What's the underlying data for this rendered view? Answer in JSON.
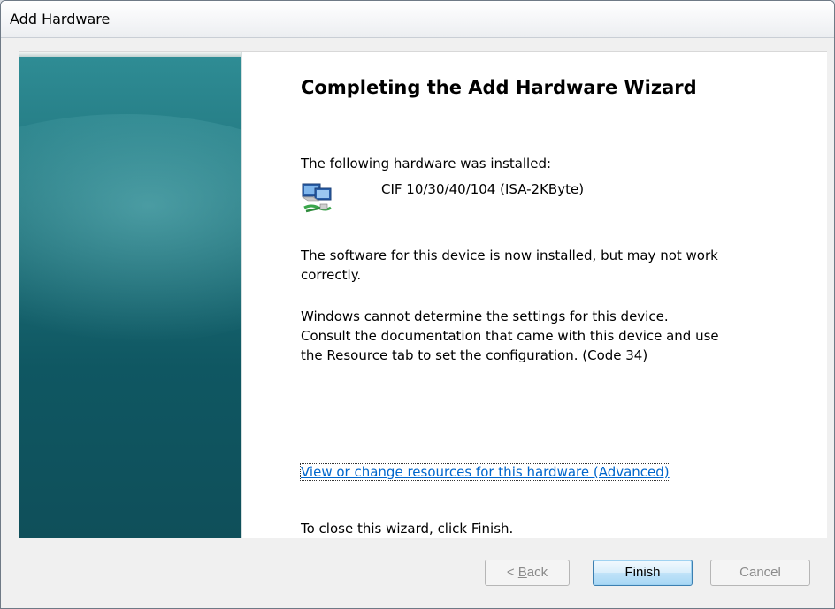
{
  "window": {
    "title": "Add Hardware"
  },
  "wizard": {
    "heading": "Completing the Add Hardware Wizard",
    "installed_label": "The following hardware was installed:",
    "device_icon": "network-adapter-icon",
    "device_name": "CIF 10/30/40/104 (ISA-2KByte)",
    "status_line1": "The software for this device is now installed, but may not work",
    "status_line2": "correctly.",
    "error_line1": "Windows cannot determine the settings for this device.",
    "error_line2": "Consult the documentation that came with this device and use",
    "error_line3": "the Resource tab to set the configuration. (Code 34)",
    "advanced_link": "View or change resources for this hardware (Advanced)",
    "close_hint": "To close this wizard, click Finish."
  },
  "buttons": {
    "back_prefix": "< ",
    "back_accel": "B",
    "back_rest": "ack",
    "finish": "Finish",
    "cancel": "Cancel"
  },
  "colors": {
    "side_panel": "#1d6f78",
    "link": "#0066cc",
    "default_button": "#bfe2f8"
  }
}
